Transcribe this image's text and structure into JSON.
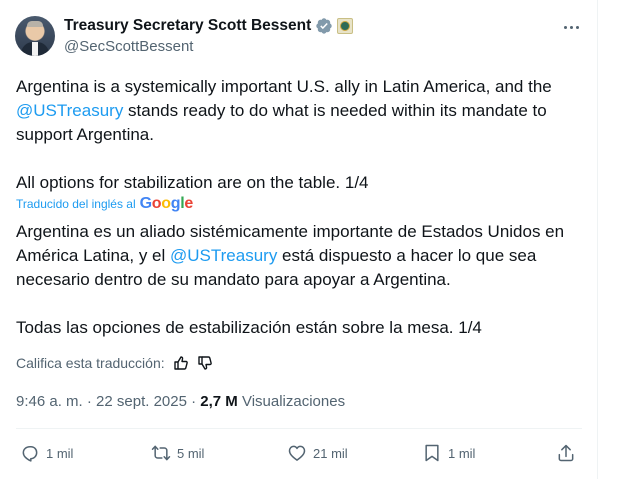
{
  "author": {
    "name": "Treasury Secretary Scott Bessent",
    "handle": "@SecScottBessent"
  },
  "original": {
    "p1_part1": "Argentina is a systemically important U.S. ally in Latin America, and the",
    "mention": "@USTreasury",
    "p1_part2": " stands ready to do what is needed within its mandate to",
    "p1_part3": "support Argentina.",
    "p2": "All options for stabilization are on the table. 1/4"
  },
  "translation_label": "Traducido del inglés al",
  "translation_provider": "Google",
  "translated": {
    "line1": "Argentina es un aliado sistémicamente importante de Estados Unidos en",
    "line2_part1": "América Latina, y el ",
    "mention": "@USTreasury",
    "line2_part2": " está dispuesto a hacer lo que sea",
    "line3": "necesario dentro de su mandato para apoyar a Argentina.",
    "p2": "Todas las opciones de estabilización están sobre la mesa. 1/4"
  },
  "rate_translation": "Califica esta traducción:",
  "meta": {
    "time_date": "9:46 a. m. · 22 sept. 2025 · ",
    "views_count": "2,7 M",
    "views_label": " Visualizaciones"
  },
  "actions": {
    "replies": "1 mil",
    "reposts": "5 mil",
    "likes": "21 mil",
    "bookmarks": "1 mil"
  },
  "colors": {
    "accent": "#1d9bf0",
    "secondary_text": "#536471",
    "verified_badge": "#829aab"
  },
  "icons": [
    "verified-badge-icon",
    "affiliate-seal-icon",
    "more-icon",
    "thumbs-up-icon",
    "thumbs-down-icon",
    "reply-icon",
    "repost-icon",
    "like-icon",
    "bookmark-icon",
    "share-icon"
  ]
}
